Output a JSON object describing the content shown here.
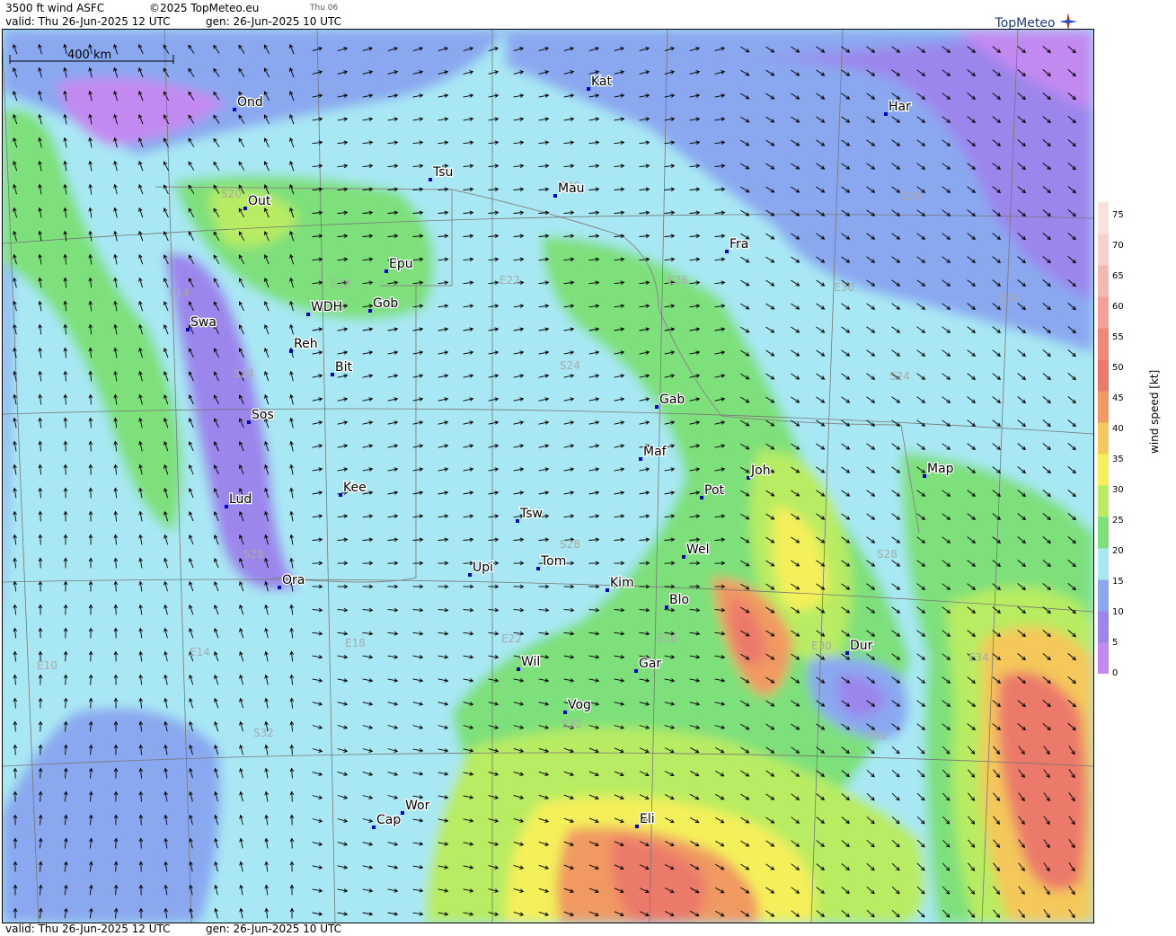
{
  "header": {
    "title": "3500 ft wind ASFC",
    "copyright": "©2025 TopMeteo.eu",
    "day_code": "Thu 06",
    "valid_top": "valid:  Thu  26-Jun-2025  12 UTC",
    "gen_top": "gen: 26-Jun-2025 10 UTC",
    "valid_bottom": "valid:  Thu  26-Jun-2025  12 UTC",
    "gen_bottom": "gen: 26-Jun-2025 10 UTC",
    "brand": "TopMeteo"
  },
  "scale_bar": {
    "label": "400 km"
  },
  "places": [
    "Ond",
    "Kat",
    "Har",
    "Tsu",
    "Mau",
    "Out",
    "Fra",
    "Epu",
    "WDH",
    "Gob",
    "Swa",
    "Reh",
    "Bit",
    "Gab",
    "Sos",
    "Maf",
    "Joh",
    "Map",
    "Kee",
    "Pot",
    "Lud",
    "Tsw",
    "Wel",
    "Upi",
    "Tom",
    "Kim",
    "Ora",
    "Blo",
    "Dur",
    "Wil",
    "Gar",
    "Vog",
    "Wor",
    "Cap",
    "Eli"
  ],
  "grid_labels": [
    "S20",
    "S20",
    "S20",
    "E14",
    "E18",
    "E22",
    "E26",
    "E30",
    "E34",
    "S24",
    "S24",
    "S24",
    "S28",
    "S28",
    "S28",
    "E10",
    "E14",
    "E18",
    "E22",
    "E26",
    "E30",
    "E34",
    "S32",
    "S32",
    "S32"
  ],
  "legend": {
    "title": "wind speed  [kt]",
    "ticks": [
      "0",
      "5",
      "10",
      "15",
      "20",
      "25",
      "30",
      "35",
      "40",
      "45",
      "50",
      "55",
      "60",
      "65",
      "70",
      "75"
    ],
    "colors": [
      "#c28af0",
      "#9c86ec",
      "#8aa8f0",
      "#a8e8f4",
      "#7ee07a",
      "#b8ec62",
      "#f4f05a",
      "#f4c85a",
      "#f09a62",
      "#ec7a6a",
      "#f08878",
      "#f2a098",
      "#f4b8b2",
      "#f6d0cc",
      "#f8e2e0"
    ]
  },
  "colors": {
    "frame": "#000000",
    "label": "#000000",
    "marker": "#0000cc",
    "grid": "#777777",
    "grid_label": "#aaaaaa"
  }
}
